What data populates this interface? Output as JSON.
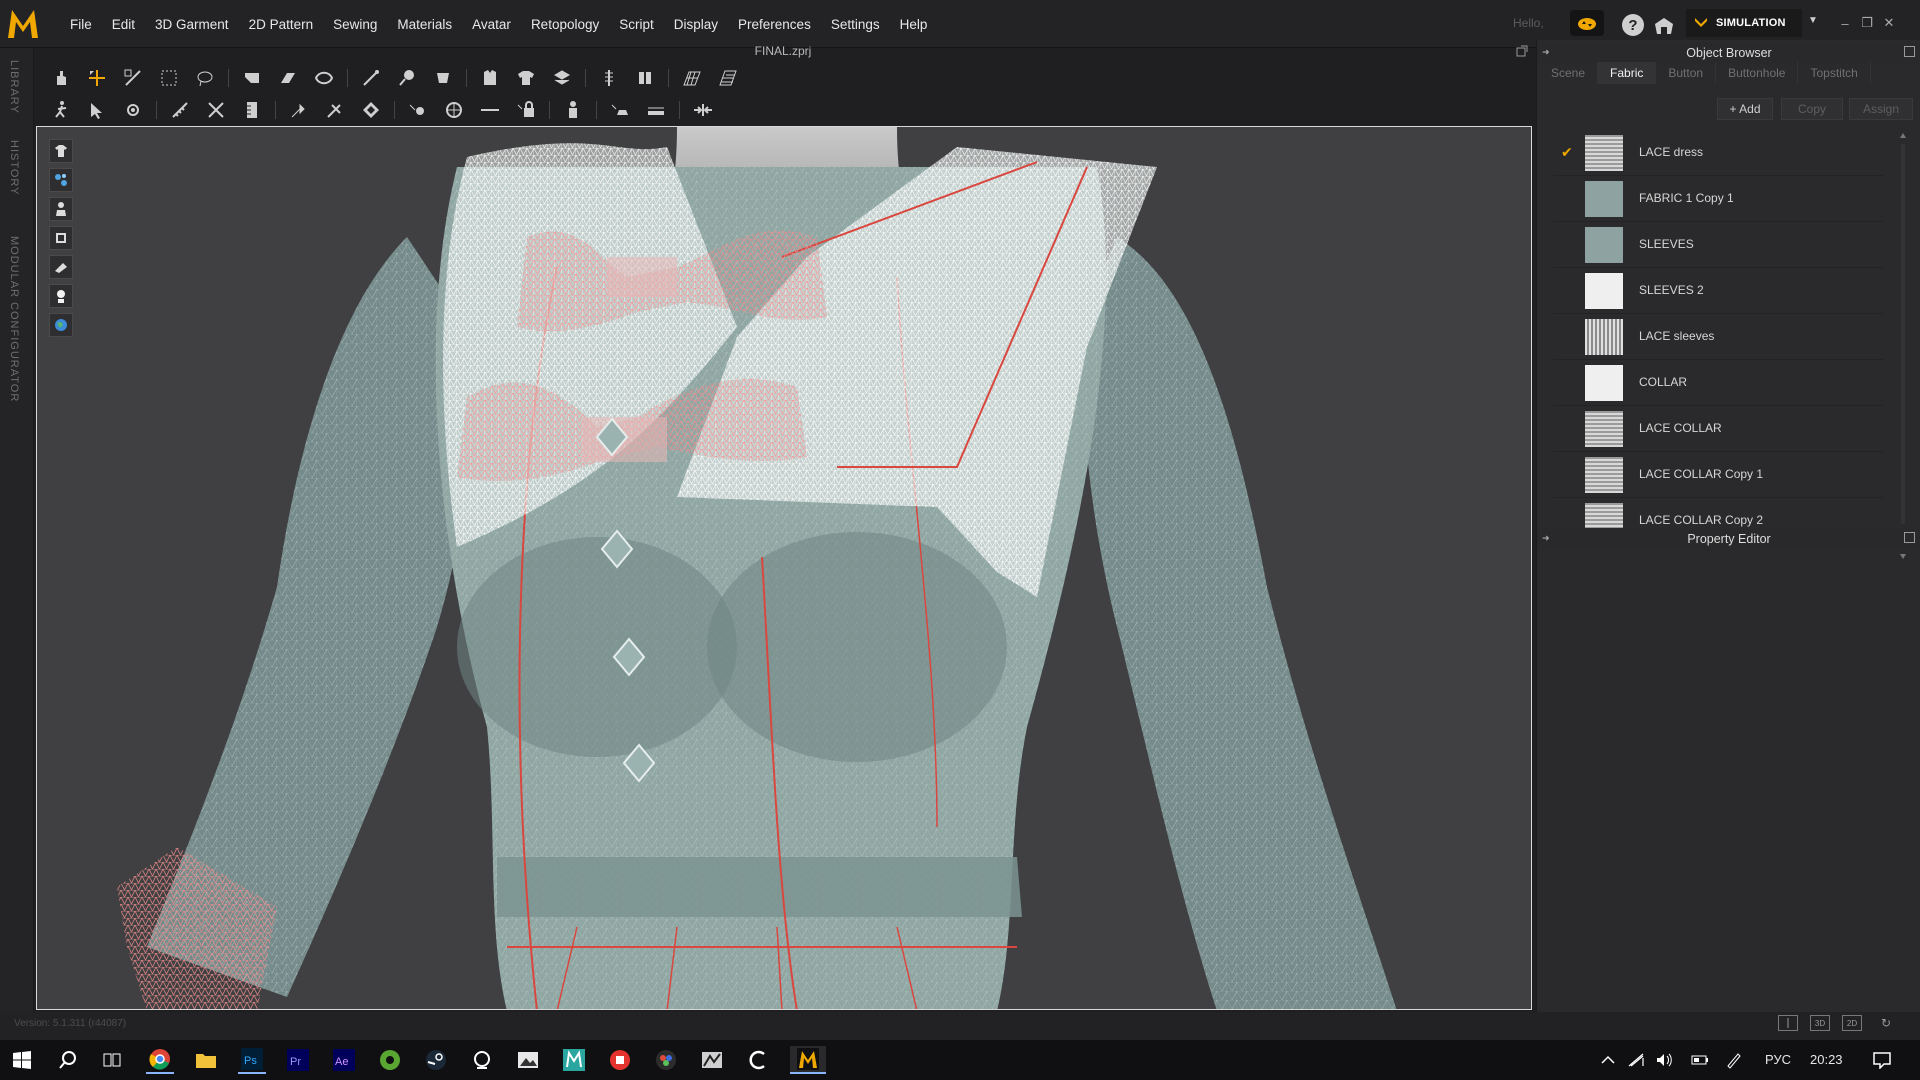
{
  "app": {
    "logo_letter": "M",
    "file_title": "FINAL.zprj",
    "greeting": "Hello,",
    "mode": "SIMULATION",
    "version": "Version: 5.1.311 (r44087)"
  },
  "menu": [
    "File",
    "Edit",
    "3D Garment",
    "2D Pattern",
    "Sewing",
    "Materials",
    "Avatar",
    "Retopology",
    "Script",
    "Display",
    "Preferences",
    "Settings",
    "Help"
  ],
  "left_tabs": [
    "LIBRARY",
    "HISTORY",
    "MODULAR CONFIGURATOR"
  ],
  "object_browser": {
    "title": "Object Browser",
    "tabs": [
      "Scene",
      "Fabric",
      "Button",
      "Buttonhole",
      "Topstitch"
    ],
    "active_tab": "Fabric",
    "actions": {
      "add": "+ Add",
      "copy": "Copy",
      "assign": "Assign"
    },
    "fabrics": [
      {
        "name": "LACE dress",
        "checked": true,
        "swatch": "lace"
      },
      {
        "name": "FABRIC 1 Copy 1",
        "checked": false,
        "swatch": "teal"
      },
      {
        "name": "SLEEVES",
        "checked": false,
        "swatch": "teal"
      },
      {
        "name": "SLEEVES 2",
        "checked": false,
        "swatch": "white"
      },
      {
        "name": "LACE sleeves",
        "checked": false,
        "swatch": "lace-dark"
      },
      {
        "name": "COLLAR",
        "checked": false,
        "swatch": "white"
      },
      {
        "name": "LACE COLLAR",
        "checked": false,
        "swatch": "lace"
      },
      {
        "name": "LACE COLLAR Copy 1",
        "checked": false,
        "swatch": "lace"
      },
      {
        "name": "LACE COLLAR Copy 2",
        "checked": false,
        "swatch": "lace"
      }
    ]
  },
  "property_editor": {
    "title": "Property Editor"
  },
  "taskbar": {
    "language": "РУС",
    "time": "20:23"
  },
  "colors": {
    "accent": "#f0a800",
    "viewport_bg": "#404042",
    "garment": "#8fa6a3",
    "seam": "#d9473f",
    "lace": "#f2f2f2"
  }
}
